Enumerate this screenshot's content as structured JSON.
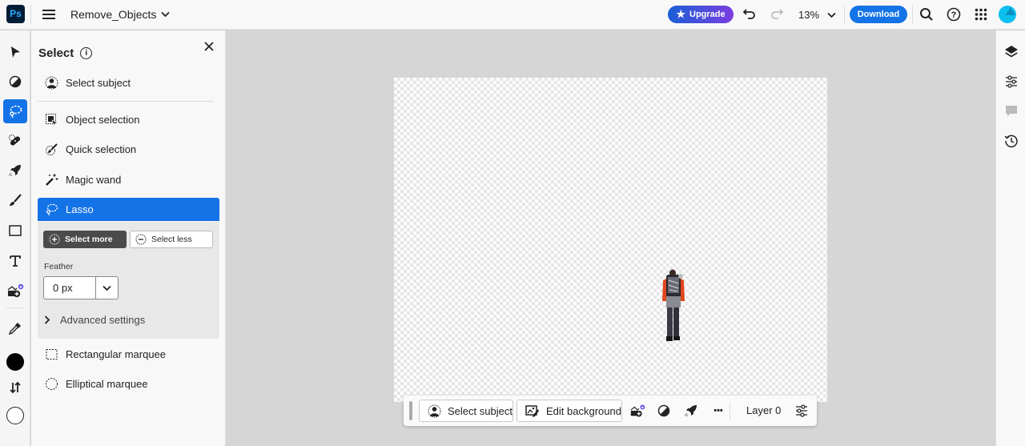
{
  "app": {
    "logo": "Ps",
    "document_title": "Remove_Objects"
  },
  "topbar": {
    "upgrade_label": "Upgrade",
    "zoom_level": "13%",
    "download_label": "Download",
    "icons": [
      "menu-icon",
      "undo-icon",
      "redo-icon",
      "search-icon",
      "help-icon",
      "apps-grid-icon",
      "avatar"
    ]
  },
  "left_toolbar": {
    "tools": [
      {
        "name": "move-tool",
        "icon": "arrow-cursor-icon",
        "active": false
      },
      {
        "name": "adjust-tool",
        "icon": "half-circle-icon",
        "active": false
      },
      {
        "name": "lasso-tool",
        "icon": "lasso-icon",
        "active": true
      },
      {
        "name": "healing-tool",
        "icon": "bandage-icon",
        "active": false
      },
      {
        "name": "quick-actions-tool",
        "icon": "rocket-icon",
        "active": false
      },
      {
        "name": "brush-tool",
        "icon": "brush-icon",
        "active": false
      },
      {
        "name": "shape-tool",
        "icon": "rectangle-icon",
        "active": false
      },
      {
        "name": "type-tool",
        "icon": "text-icon",
        "active": false
      },
      {
        "name": "add-image-tool",
        "icon": "add-image-icon",
        "active": false
      },
      {
        "name": "eyedropper-tool",
        "icon": "eyedropper-icon",
        "active": false
      }
    ],
    "foreground_color": "#000000",
    "background_color": "#ffffff"
  },
  "select_panel": {
    "title": "Select",
    "close_label": "×",
    "items": [
      {
        "label": "Select subject",
        "icon": "select-subject-icon"
      },
      {
        "label": "Object selection",
        "icon": "object-selection-icon"
      },
      {
        "label": "Quick selection",
        "icon": "quick-selection-icon"
      },
      {
        "label": "Magic wand",
        "icon": "magic-wand-icon"
      },
      {
        "label": "Lasso",
        "icon": "lasso-icon",
        "active": true
      },
      {
        "label": "Rectangular marquee",
        "icon": "rect-marquee-icon"
      },
      {
        "label": "Elliptical marquee",
        "icon": "ellipse-marquee-icon"
      }
    ],
    "lasso_options": {
      "select_more": "Select more",
      "select_less": "Select less",
      "feather_label": "Feather",
      "feather_value": "0 px",
      "advanced_settings": "Advanced settings"
    }
  },
  "taskbar": {
    "select_subject": "Select subject",
    "edit_background": "Edit background",
    "more_label": "•••",
    "layer_label": "Layer 0"
  },
  "right_rail": {
    "icons": [
      "layers-icon",
      "adjustments-icon",
      "comments-icon",
      "history-icon"
    ]
  },
  "colors": {
    "accent": "#1473e6",
    "upgrade_gradient_start": "#1a5fd6",
    "upgrade_gradient_end": "#7a3ee0"
  }
}
